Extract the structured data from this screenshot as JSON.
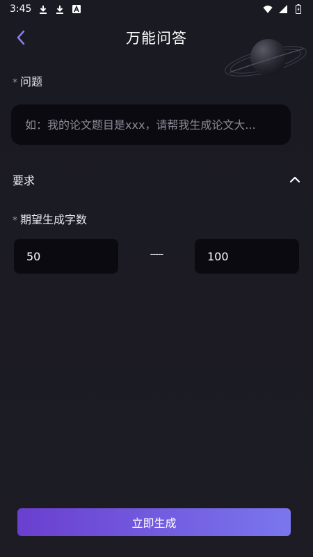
{
  "status_bar": {
    "time": "3:45",
    "notification_icons": [
      "download-icon",
      "download-icon",
      "a-icon"
    ],
    "system_icons": [
      "wifi-icon",
      "signal-icon",
      "battery-icon"
    ]
  },
  "header": {
    "title": "万能问答",
    "back_icon": "chevron-left-icon",
    "accent_color": "#8b7cf6"
  },
  "question": {
    "required_mark": "*",
    "label": "问题",
    "placeholder": "如：我的论文题目是xxx，请帮我生成论文大..."
  },
  "requirements": {
    "title": "要求",
    "toggle_icon": "chevron-up-icon",
    "word_count": {
      "required_mark": "*",
      "label": "期望生成字数",
      "min_value": "50",
      "separator": "-----",
      "max_value": "100"
    }
  },
  "actions": {
    "generate_label": "立即生成",
    "gradient_start": "#6a3fcf",
    "gradient_end": "#7a76ee"
  }
}
